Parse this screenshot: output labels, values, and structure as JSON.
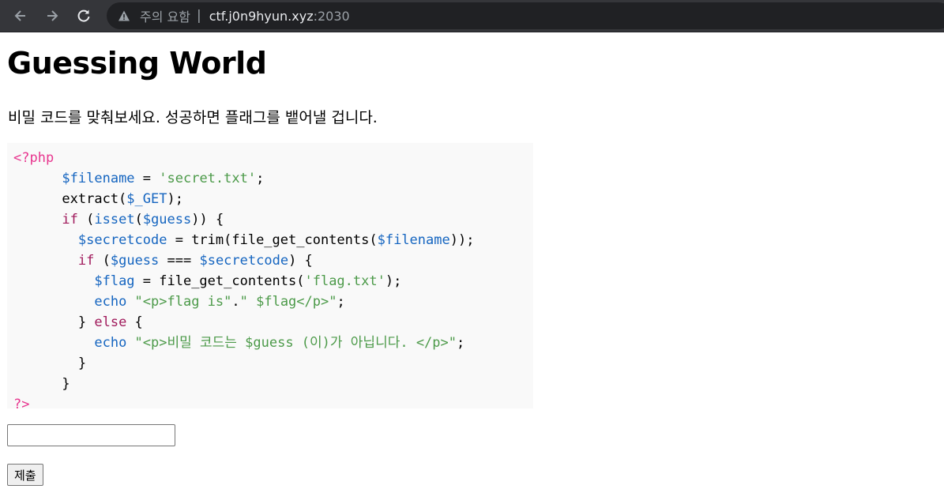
{
  "browser": {
    "security_warning": "주의 요함",
    "separator": "|",
    "url_host": "ctf.j0n9hyun.xyz",
    "url_port": ":2030",
    "icons": [
      "back-arrow-icon",
      "forward-arrow-icon",
      "reload-icon",
      "warning-triangle-icon"
    ]
  },
  "page": {
    "title": "Guessing World",
    "intro": "비밀 코드를 맞춰보세요. 성공하면 플래그를 뱉어낼 겁니다.",
    "code_lines": [
      [
        {
          "t": "<?php",
          "c": "php"
        }
      ],
      [
        {
          "t": "      ",
          "c": "pl"
        },
        {
          "t": "$filename",
          "c": "var"
        },
        {
          "t": " = ",
          "c": "pl"
        },
        {
          "t": "'secret.txt'",
          "c": "str"
        },
        {
          "t": ";",
          "c": "pl"
        }
      ],
      [
        {
          "t": "      extract(",
          "c": "pl"
        },
        {
          "t": "$_GET",
          "c": "var"
        },
        {
          "t": ");",
          "c": "pl"
        }
      ],
      [
        {
          "t": "      ",
          "c": "pl"
        },
        {
          "t": "if",
          "c": "kw"
        },
        {
          "t": " (",
          "c": "pl"
        },
        {
          "t": "isset",
          "c": "fn"
        },
        {
          "t": "(",
          "c": "pl"
        },
        {
          "t": "$guess",
          "c": "var"
        },
        {
          "t": ")) {",
          "c": "pl"
        }
      ],
      [
        {
          "t": "        ",
          "c": "pl"
        },
        {
          "t": "$secretcode",
          "c": "var"
        },
        {
          "t": " = trim(file_get_contents(",
          "c": "pl"
        },
        {
          "t": "$filename",
          "c": "var"
        },
        {
          "t": "));",
          "c": "pl"
        }
      ],
      [
        {
          "t": "        ",
          "c": "pl"
        },
        {
          "t": "if",
          "c": "kw"
        },
        {
          "t": " (",
          "c": "pl"
        },
        {
          "t": "$guess",
          "c": "var"
        },
        {
          "t": " === ",
          "c": "pl"
        },
        {
          "t": "$secretcode",
          "c": "var"
        },
        {
          "t": ") {",
          "c": "pl"
        }
      ],
      [
        {
          "t": "          ",
          "c": "pl"
        },
        {
          "t": "$flag",
          "c": "var"
        },
        {
          "t": " = file_get_contents(",
          "c": "pl"
        },
        {
          "t": "'flag.txt'",
          "c": "str"
        },
        {
          "t": ");",
          "c": "pl"
        }
      ],
      [
        {
          "t": "          ",
          "c": "pl"
        },
        {
          "t": "echo",
          "c": "fn"
        },
        {
          "t": " \"",
          "c": "str"
        },
        {
          "t": "<p>flag is\"",
          "c": "str"
        },
        {
          "t": ".",
          "c": "pl"
        },
        {
          "t": "\" $flag</p>\"",
          "c": "str"
        },
        {
          "t": ";",
          "c": "pl"
        }
      ],
      [
        {
          "t": "        } ",
          "c": "pl"
        },
        {
          "t": "else",
          "c": "kw"
        },
        {
          "t": " {",
          "c": "pl"
        }
      ],
      [
        {
          "t": "          ",
          "c": "pl"
        },
        {
          "t": "echo",
          "c": "fn"
        },
        {
          "t": " \"<p>비밀 코드는 $guess (이)가 아닙니다. </p>\"",
          "c": "str"
        },
        {
          "t": ";",
          "c": "pl"
        }
      ],
      [
        {
          "t": "        }",
          "c": "pl"
        }
      ],
      [
        {
          "t": "      }",
          "c": "pl"
        }
      ],
      [
        {
          "t": "?>",
          "c": "php"
        }
      ]
    ],
    "input_value": "",
    "submit_label": "제출"
  }
}
